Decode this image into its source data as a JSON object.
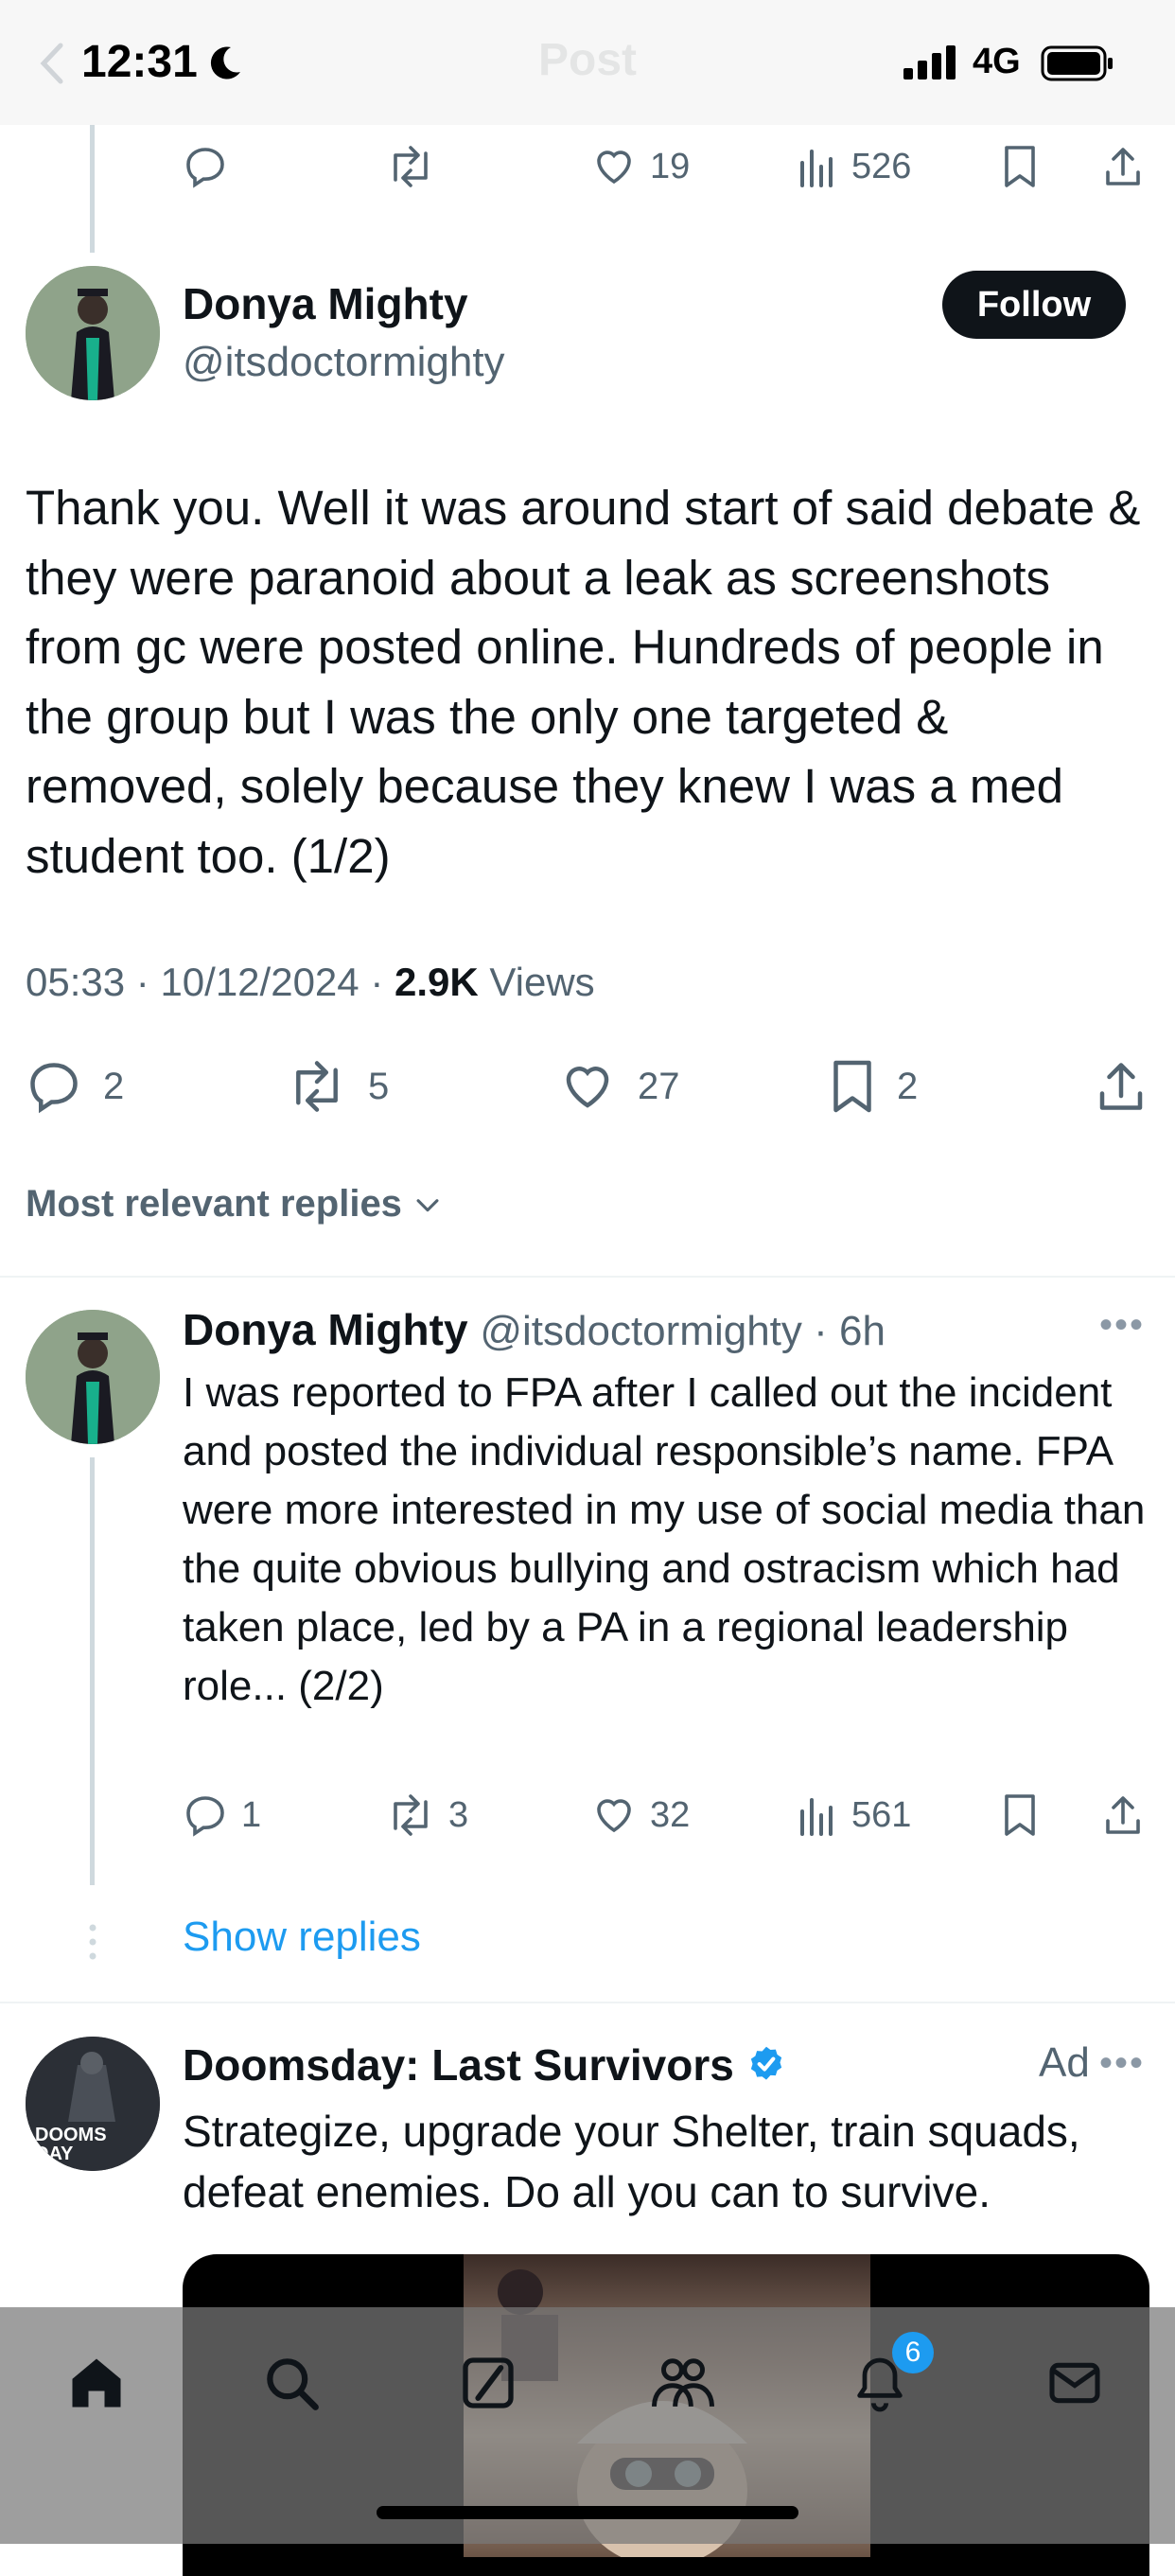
{
  "status": {
    "time": "12:31",
    "network": "4G"
  },
  "header": {
    "title": "Post"
  },
  "prev_actions": {
    "likes": "19",
    "views": "526"
  },
  "post": {
    "author_name": "Donya Mighty",
    "author_handle": "@itsdoctormighty",
    "follow_label": "Follow",
    "text": "Thank you. Well it was around start of said debate & they were paranoid about a leak as screenshots from gc were posted online. Hundreds of people in the group but I was the only one targeted & removed, solely because they knew I was a med student too. (1/2)",
    "time": "05:33",
    "date": "10/12/2024",
    "views_count": "2.9K",
    "views_label": "Views",
    "replies": "2",
    "reposts": "5",
    "likes": "27",
    "bookmarks": "2"
  },
  "sort": {
    "label": "Most relevant replies"
  },
  "reply": {
    "author_name": "Donya Mighty",
    "author_handle": "@itsdoctormighty",
    "age": "6h",
    "text": "I was reported to FPA after I called out the incident and posted the individual responsible’s name. FPA were more interested in my use of social media than the quite obvious bullying and ostracism which had taken place, led by a PA in a regional leadership role... (2/2)",
    "replies": "1",
    "reposts": "3",
    "likes": "32",
    "views": "561",
    "show_replies": "Show replies"
  },
  "ad": {
    "name": "Doomsday: Last Survivors",
    "label": "Ad",
    "text": "Strategize, upgrade your Shelter, train squads, defeat enemies. Do all you can to survive.",
    "avatar_text": "DOOMS DAY"
  },
  "nav": {
    "notifications_badge": "6"
  },
  "colors": {
    "accent": "#1d9bf0",
    "text": "#0f1419",
    "muted": "#536471"
  }
}
